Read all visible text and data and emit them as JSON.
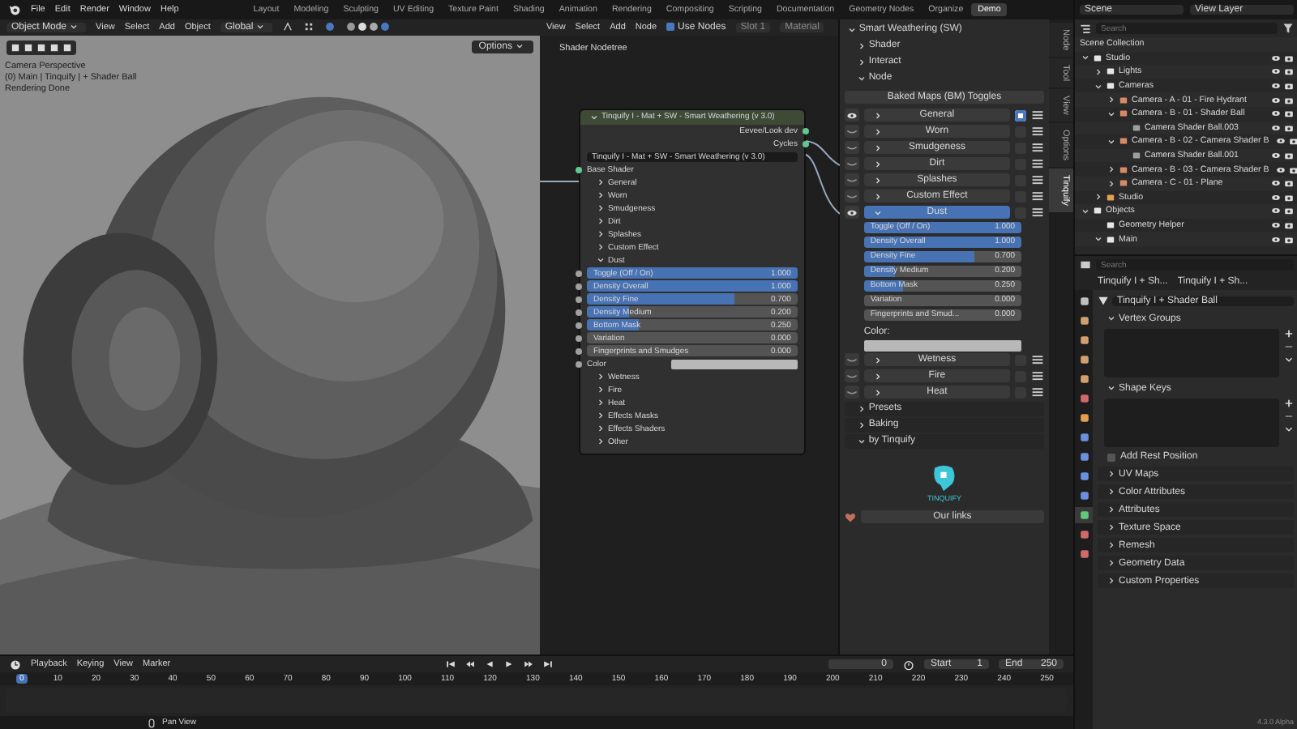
{
  "topbar": {
    "menus": [
      "File",
      "Edit",
      "Render",
      "Window",
      "Help"
    ],
    "workspaces": [
      {
        "label": "Layout",
        "selected": false
      },
      {
        "label": "Modeling",
        "selected": false
      },
      {
        "label": "Sculpting",
        "selected": false
      },
      {
        "label": "UV Editing",
        "selected": false
      },
      {
        "label": "Texture Paint",
        "selected": false
      },
      {
        "label": "Shading",
        "selected": false
      },
      {
        "label": "Animation",
        "selected": false
      },
      {
        "label": "Rendering",
        "selected": false
      },
      {
        "label": "Compositing",
        "selected": false
      },
      {
        "label": "Scripting",
        "selected": false
      },
      {
        "label": "Documentation",
        "selected": false
      },
      {
        "label": "Geometry Nodes",
        "selected": false
      },
      {
        "label": "Organize",
        "selected": false
      },
      {
        "label": "Demo",
        "selected": true
      }
    ]
  },
  "viewport": {
    "mode": "Object Mode",
    "menus": [
      "View",
      "Select",
      "Add",
      "Object"
    ],
    "orientation": "Global",
    "options": "Options",
    "overlay": [
      "Camera Perspective",
      "(0) Main | Tinquify | + Shader Ball",
      "Rendering Done"
    ]
  },
  "node_editor": {
    "menus": [
      "View",
      "Select",
      "Add",
      "Node"
    ],
    "use_nodes": {
      "label": "Use Nodes",
      "checked": true
    },
    "slot": "Slot 1",
    "material": "Material",
    "breadcrumb": "Shader Nodetree",
    "node": {
      "title": "Tinquify I - Mat + SW - Smart Weathering (v 3.0)",
      "outputs": [
        "Eevee/Look dev",
        "Cycles"
      ],
      "datablock": "Tinquify I - Mat + SW - Smart Weathering (v 3.0)",
      "input": "Base Shader",
      "panels": [
        {
          "label": "General",
          "expanded": false
        },
        {
          "label": "Worn",
          "expanded": false
        },
        {
          "label": "Smudgeness",
          "expanded": false
        },
        {
          "label": "Dirt",
          "expanded": false
        },
        {
          "label": "Splashes",
          "expanded": false
        },
        {
          "label": "Custom Effect",
          "expanded": false
        },
        {
          "label": "Dust",
          "expanded": true,
          "sliders": [
            {
              "label": "Toggle (Off / On)",
              "value": "1.000",
              "level": 1
            },
            {
              "label": "Density Overall",
              "value": "1.000",
              "level": 1
            },
            {
              "label": "Density Fine",
              "value": "0.700",
              "level": 0.7
            },
            {
              "label": "Density Medium",
              "value": "0.200",
              "level": 0.2
            },
            {
              "label": "Bottom Mask",
              "value": "0.250",
              "level": 0.25
            },
            {
              "label": "Variation",
              "value": "0.000",
              "level": 0
            },
            {
              "label": "Fingerprints and Smudges",
              "value": "0.000",
              "level": 0
            }
          ],
          "color_label": "Color"
        },
        {
          "label": "Wetness",
          "expanded": false
        },
        {
          "label": "Fire",
          "expanded": false
        },
        {
          "label": "Heat",
          "expanded": false
        },
        {
          "label": "Effects Masks",
          "expanded": false
        },
        {
          "label": "Effects Shaders",
          "expanded": false
        },
        {
          "label": "Other",
          "expanded": false
        }
      ]
    }
  },
  "npanel": {
    "title": "Smart Weathering (SW)",
    "expanded": true,
    "subpanels": [
      {
        "label": "Shader",
        "expanded": false
      },
      {
        "label": "Interact",
        "expanded": false
      },
      {
        "label": "Node",
        "expanded": true
      }
    ],
    "baked_toggle": "Baked Maps (BM) Toggles",
    "effects": [
      {
        "label": "General",
        "visible": true,
        "enabled": true,
        "expanded": false
      },
      {
        "label": "Worn",
        "visible": false,
        "enabled": false,
        "expanded": false
      },
      {
        "label": "Smudgeness",
        "visible": false,
        "enabled": false,
        "expanded": false
      },
      {
        "label": "Dirt",
        "visible": false,
        "enabled": false,
        "expanded": false
      },
      {
        "label": "Splashes",
        "visible": false,
        "enabled": false,
        "expanded": false
      },
      {
        "label": "Custom Effect",
        "visible": false,
        "enabled": false,
        "expanded": false
      },
      {
        "label": "Dust",
        "visible": true,
        "enabled": false,
        "expanded": true,
        "sliders": [
          {
            "label": "Toggle (Off / On)",
            "value": "1.000",
            "level": 1
          },
          {
            "label": "Density Overall",
            "value": "1.000",
            "level": 1
          },
          {
            "label": "Density Fine",
            "value": "0.700",
            "level": 0.7
          },
          {
            "label": "Density Medium",
            "value": "0.200",
            "level": 0.2
          },
          {
            "label": "Bottom Mask",
            "value": "0.250",
            "level": 0.25
          },
          {
            "label": "Variation",
            "value": "0.000",
            "level": 0
          },
          {
            "label": "Fingerprints and Smud...",
            "value": "0.000",
            "level": 0
          }
        ],
        "color_label": "Color:"
      },
      {
        "label": "Wetness",
        "visible": false,
        "enabled": false,
        "expanded": false
      },
      {
        "label": "Fire",
        "visible": false,
        "enabled": false,
        "expanded": false
      },
      {
        "label": "Heat",
        "visible": false,
        "enabled": false,
        "expanded": false
      }
    ],
    "lower": [
      {
        "label": "Presets",
        "expanded": false
      },
      {
        "label": "Baking",
        "expanded": false
      },
      {
        "label": "by Tinquify",
        "expanded": true
      }
    ],
    "logo_text": "TINQUIFY",
    "links_button": "Our links",
    "tabs": [
      {
        "label": "Node",
        "selected": false
      },
      {
        "label": "Tool",
        "selected": false
      },
      {
        "label": "View",
        "selected": false
      },
      {
        "label": "Options",
        "selected": false
      },
      {
        "label": "Tinquify",
        "selected": true
      }
    ]
  },
  "timeline": {
    "menus": [
      "Playback",
      "Keying",
      "View",
      "Marker"
    ],
    "current_frame": "0",
    "start_label": "Start",
    "start": "1",
    "end_label": "End",
    "end": "250",
    "ticks": [
      {
        "label": "0",
        "selected": true
      },
      {
        "label": "10",
        "selected": false
      },
      {
        "label": "20",
        "selected": false
      },
      {
        "label": "30",
        "selected": false
      },
      {
        "label": "40",
        "selected": false
      },
      {
        "label": "50",
        "selected": false
      },
      {
        "label": "60",
        "selected": false
      },
      {
        "label": "70",
        "selected": false
      },
      {
        "label": "80",
        "selected": false
      },
      {
        "label": "90",
        "selected": false
      },
      {
        "label": "100",
        "selected": false
      },
      {
        "label": "110",
        "selected": false
      },
      {
        "label": "120",
        "selected": false
      },
      {
        "label": "130",
        "selected": false
      },
      {
        "label": "140",
        "selected": false
      },
      {
        "label": "150",
        "selected": false
      },
      {
        "label": "160",
        "selected": false
      },
      {
        "label": "170",
        "selected": false
      },
      {
        "label": "180",
        "selected": false
      },
      {
        "label": "190",
        "selected": false
      },
      {
        "label": "200",
        "selected": false
      },
      {
        "label": "210",
        "selected": false
      },
      {
        "label": "220",
        "selected": false
      },
      {
        "label": "230",
        "selected": false
      },
      {
        "label": "240",
        "selected": false
      },
      {
        "label": "250",
        "selected": false
      }
    ],
    "status": "Pan View"
  },
  "outliner": {
    "scene": "Scene",
    "view_layer": "View Layer",
    "search_placeholder": "Search",
    "root": "Scene Collection",
    "tree": [
      {
        "label": "Studio",
        "kind": "collection",
        "expanded": true,
        "children": [
          {
            "label": "Lights",
            "kind": "collection",
            "expanded": false
          },
          {
            "label": "Cameras",
            "kind": "collection",
            "expanded": true,
            "children": [
              {
                "label": "Camera - A - 01 - Fire Hydrant",
                "kind": "camera",
                "expanded": false
              },
              {
                "label": "Camera - B - 01 - Shader Ball",
                "kind": "camera",
                "expanded": true,
                "children": [
                  {
                    "label": "Camera Shader Ball.003",
                    "kind": "camera_data"
                  }
                ]
              },
              {
                "label": "Camera - B - 02 - Camera Shader B",
                "kind": "camera",
                "expanded": true,
                "children": [
                  {
                    "label": "Camera Shader Ball.001",
                    "kind": "camera_data"
                  }
                ]
              },
              {
                "label": "Camera - B - 03 - Camera Shader B",
                "kind": "camera",
                "expanded": false
              },
              {
                "label": "Camera - C - 01 - Plane",
                "kind": "camera",
                "expanded": false
              }
            ]
          },
          {
            "label": "Studio",
            "kind": "object",
            "expanded": false
          }
        ]
      },
      {
        "label": "Objects",
        "kind": "collection",
        "expanded": true,
        "children": [
          {
            "label": "Geometry Helper",
            "kind": "collection"
          },
          {
            "label": "Main",
            "kind": "collection",
            "expanded": true
          }
        ]
      }
    ]
  },
  "properties": {
    "search_placeholder": "Search",
    "breadcrumb": [
      "Tinquify I + Sh...",
      "Tinquify I + Sh..."
    ],
    "datablock": "Tinquify I + Shader Ball",
    "tabs": [
      {
        "kind": "tool",
        "selected": false
      },
      {
        "kind": "render",
        "selected": false
      },
      {
        "kind": "output",
        "selected": false
      },
      {
        "kind": "view",
        "selected": false
      },
      {
        "kind": "scene",
        "selected": false
      },
      {
        "kind": "world",
        "selected": false
      },
      {
        "kind": "object",
        "selected": false
      },
      {
        "kind": "modifier",
        "selected": false
      },
      {
        "kind": "particles",
        "selected": false
      },
      {
        "kind": "physics",
        "selected": false
      },
      {
        "kind": "constraints",
        "selected": false
      },
      {
        "kind": "data",
        "selected": true
      },
      {
        "kind": "material",
        "selected": false
      },
      {
        "kind": "texture",
        "selected": false
      }
    ],
    "list_panels": [
      {
        "label": "Vertex Groups",
        "expanded": true
      },
      {
        "label": "Shape Keys",
        "expanded": true
      }
    ],
    "rest_position": {
      "label": "Add Rest Position",
      "checked": false
    },
    "panels": [
      {
        "label": "UV Maps",
        "expanded": false
      },
      {
        "label": "Color Attributes",
        "expanded": false
      },
      {
        "label": "Attributes",
        "expanded": false
      },
      {
        "label": "Texture Space",
        "expanded": false
      },
      {
        "label": "Remesh",
        "expanded": false
      },
      {
        "label": "Geometry Data",
        "expanded": false
      },
      {
        "label": "Custom Properties",
        "expanded": false
      }
    ],
    "version": "4.3.0 Alpha"
  }
}
